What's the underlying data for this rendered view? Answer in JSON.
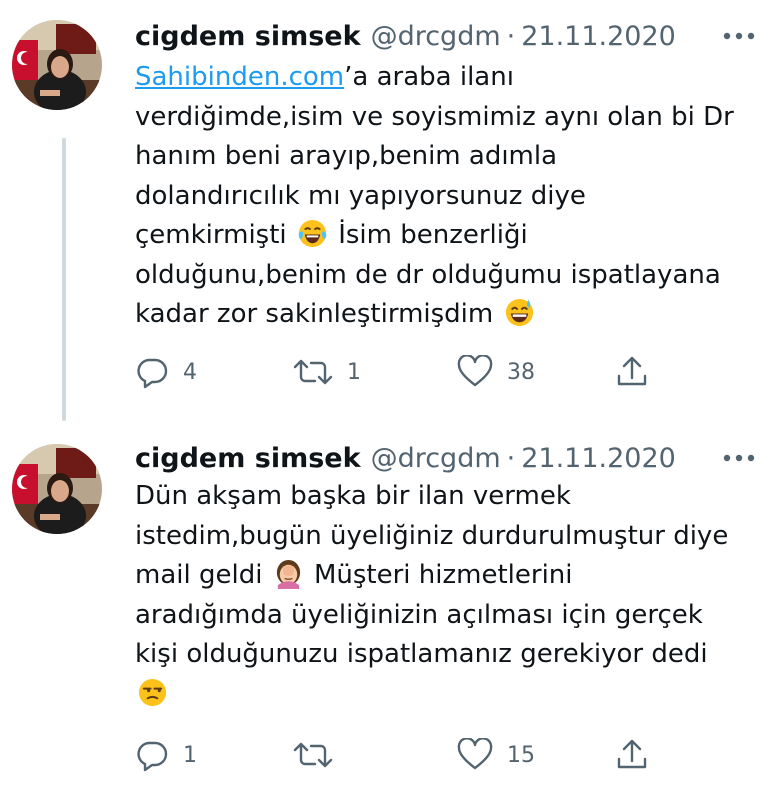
{
  "tweets": [
    {
      "author_name": "cigdem simsek",
      "handle": "@drcgdm",
      "separator": "·",
      "date": "21.11.2020",
      "lines": [
        {
          "link": "Sahibinden.com",
          "text": "’a araba ilanı"
        },
        {
          "text": "verdiğimde,isim ve soyismimiz aynı olan bi Dr"
        },
        {
          "text": "hanım beni arayıp,benim adımla"
        },
        {
          "text": "dolandırıcılık mı yapıyorsunuz diye"
        },
        {
          "text": "çemkirmişti",
          "emoji": "face-with-tears-of-joy",
          "after": "İsim benzerliği"
        },
        {
          "text": "olduğunu,benim de dr olduğumu ispatlayana"
        },
        {
          "text": "kadar zor sakinleştirmişdim",
          "emoji": "grinning-face-with-sweat"
        }
      ],
      "replies": "4",
      "retweets": "1",
      "likes": "38"
    },
    {
      "author_name": "cigdem simsek",
      "handle": "@drcgdm",
      "separator": "·",
      "date": "21.11.2020",
      "lines": [
        {
          "text": "Dün akşam başka bir ilan vermek"
        },
        {
          "text": "istedim,bugün üyeliğiniz durdurulmuştur diye"
        },
        {
          "text": "mail geldi",
          "emoji": "woman-facepalming",
          "after": "Müşteri hizmetlerini"
        },
        {
          "text": "aradığımda üyeliğinizin açılması için gerçek"
        },
        {
          "text": "kişi olduğunuzu ispatlamanız gerekiyor dedi"
        },
        {
          "emoji": "unamused-face"
        }
      ],
      "replies": "1",
      "retweets": "",
      "likes": "15"
    }
  ],
  "icons": {
    "more": "more-horizontal-icon",
    "reply": "reply-icon",
    "retweet": "retweet-icon",
    "like": "heart-icon",
    "share": "share-icon"
  },
  "colors": {
    "text": "#0f1419",
    "secondary": "#536471",
    "link": "#1d9bf0",
    "thread_line": "#cfd9de"
  }
}
